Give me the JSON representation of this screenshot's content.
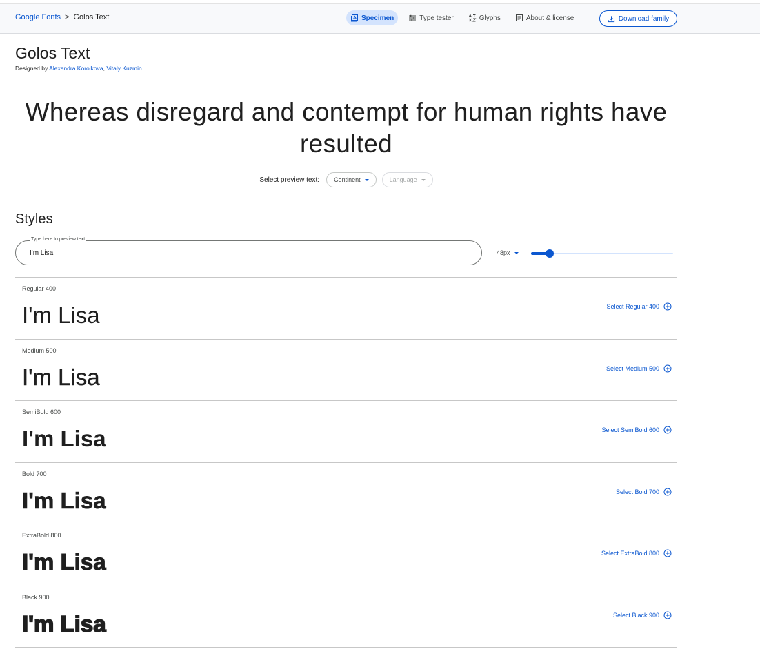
{
  "breadcrumb": {
    "root": "Google Fonts",
    "separator": ">",
    "current": "Golos Text"
  },
  "tabs": [
    {
      "label": "Specimen",
      "icon": "specimen-icon",
      "active": true
    },
    {
      "label": "Type tester",
      "icon": "tune-icon",
      "active": false
    },
    {
      "label": "Glyphs",
      "icon": "glyphs-icon",
      "active": false
    },
    {
      "label": "About & license",
      "icon": "article-icon",
      "active": false
    }
  ],
  "download_button": {
    "label": "Download family",
    "icon": "download-icon"
  },
  "font": {
    "name": "Golos Text",
    "designed_by_prefix": "Designed by",
    "designer_1": "Alexandra Korolkova",
    "designer_separator": ",",
    "designer_2": "Vitaly Kuzmin"
  },
  "hero_text": "Whereas disregard and contempt for human rights have resulted",
  "preview_text_selector": {
    "label": "Select preview text:",
    "continent": "Continent",
    "language": "Language"
  },
  "styles_section": {
    "heading": "Styles",
    "input_label": "Type here to preview text",
    "input_value": "I'm Lisa",
    "size_label": "48px",
    "size_slider_fraction": 0.13
  },
  "styles": [
    {
      "name": "Regular 400",
      "sample": "I'm Lisa",
      "select_label": "Select Regular 400"
    },
    {
      "name": "Medium 500",
      "sample": "I'm Lisa",
      "select_label": "Select Medium 500"
    },
    {
      "name": "SemiBold 600",
      "sample": "I'm Lisa",
      "select_label": "Select SemiBold 600"
    },
    {
      "name": "Bold 700",
      "sample": "I'm Lisa",
      "select_label": "Select Bold 700"
    },
    {
      "name": "ExtraBold 800",
      "sample": "I'm Lisa",
      "select_label": "Select ExtraBold 800"
    },
    {
      "name": "Black 900",
      "sample": "I'm Lisa",
      "select_label": "Select Black 900"
    }
  ],
  "colors": {
    "accent": "#0b57d0",
    "active_tab_bg": "#d3e3fd",
    "text": "#1f1f1f"
  }
}
